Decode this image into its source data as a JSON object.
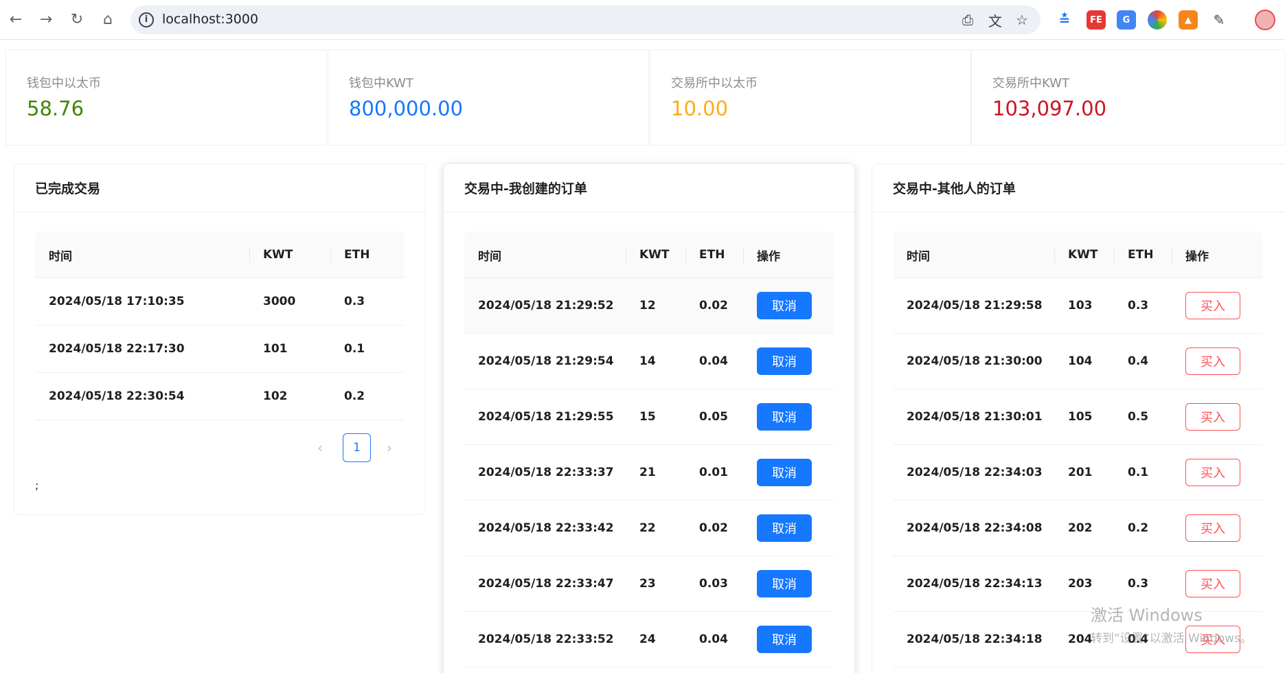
{
  "browser": {
    "url": "localhost:3000"
  },
  "stats": [
    {
      "title": "钱包中以太币",
      "value": "58.76",
      "color": "#3f8600"
    },
    {
      "title": "钱包中KWT",
      "value": "800,000.00",
      "color": "#1677ff"
    },
    {
      "title": "交易所中以太币",
      "value": "10.00",
      "color": "#faad14"
    },
    {
      "title": "交易所中KWT",
      "value": "103,097.00",
      "color": "#cf1322"
    }
  ],
  "completed": {
    "title": "已完成交易",
    "columns": [
      "时间",
      "KWT",
      "ETH"
    ],
    "rows": [
      {
        "time": "2024/05/18 17:10:35",
        "kwt": "3000",
        "eth": "0.3"
      },
      {
        "time": "2024/05/18 22:17:30",
        "kwt": "101",
        "eth": "0.1"
      },
      {
        "time": "2024/05/18 22:30:54",
        "kwt": "102",
        "eth": "0.2"
      }
    ],
    "pagination": {
      "prev": "‹",
      "current": "1",
      "next": "›"
    },
    "trailing_text": ";"
  },
  "my_orders": {
    "title": "交易中-我创建的订单",
    "columns": [
      "时间",
      "KWT",
      "ETH",
      "操作"
    ],
    "action_label": "取消",
    "rows": [
      {
        "time": "2024/05/18 21:29:52",
        "kwt": "12",
        "eth": "0.02"
      },
      {
        "time": "2024/05/18 21:29:54",
        "kwt": "14",
        "eth": "0.04"
      },
      {
        "time": "2024/05/18 21:29:55",
        "kwt": "15",
        "eth": "0.05"
      },
      {
        "time": "2024/05/18 22:33:37",
        "kwt": "21",
        "eth": "0.01"
      },
      {
        "time": "2024/05/18 22:33:42",
        "kwt": "22",
        "eth": "0.02"
      },
      {
        "time": "2024/05/18 22:33:47",
        "kwt": "23",
        "eth": "0.03"
      },
      {
        "time": "2024/05/18 22:33:52",
        "kwt": "24",
        "eth": "0.04"
      }
    ]
  },
  "other_orders": {
    "title": "交易中-其他人的订单",
    "columns": [
      "时间",
      "KWT",
      "ETH",
      "操作"
    ],
    "action_label": "买入",
    "rows": [
      {
        "time": "2024/05/18 21:29:58",
        "kwt": "103",
        "eth": "0.3"
      },
      {
        "time": "2024/05/18 21:30:00",
        "kwt": "104",
        "eth": "0.4"
      },
      {
        "time": "2024/05/18 21:30:01",
        "kwt": "105",
        "eth": "0.5"
      },
      {
        "time": "2024/05/18 22:34:03",
        "kwt": "201",
        "eth": "0.1"
      },
      {
        "time": "2024/05/18 22:34:08",
        "kwt": "202",
        "eth": "0.2"
      },
      {
        "time": "2024/05/18 22:34:13",
        "kwt": "203",
        "eth": "0.3"
      },
      {
        "time": "2024/05/18 22:34:18",
        "kwt": "204",
        "eth": "0.4"
      }
    ]
  },
  "watermark": {
    "line1": "激活 Windows",
    "line2": "转到“设置”以激活 Windows。"
  }
}
